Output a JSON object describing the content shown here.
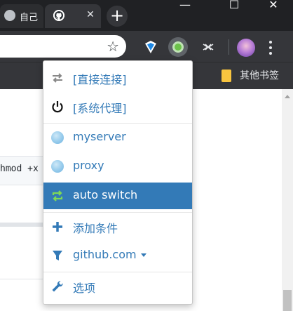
{
  "tabs": [
    {
      "label": "自己"
    },
    {
      "label": ""
    }
  ],
  "window": {
    "minimize": "—",
    "maximize": "☐",
    "close": "✕",
    "new_tab": "+"
  },
  "bookmarks": {
    "other_label": "其他书签"
  },
  "content": {
    "code_text": "hmod +x"
  },
  "menu": {
    "items": [
      {
        "label": "[直接连接]",
        "icon": "swap-arrows-icon"
      },
      {
        "label": "[系统代理]",
        "icon": "power-icon"
      },
      {
        "label": "myserver",
        "icon": "globe-icon"
      },
      {
        "label": "proxy",
        "icon": "globe-icon"
      },
      {
        "label": "auto switch",
        "icon": "auto-switch-icon",
        "active": true
      },
      {
        "label": "添加条件",
        "icon": "plus-icon"
      },
      {
        "label": "github.com",
        "icon": "filter-icon"
      },
      {
        "label": "选项",
        "icon": "wrench-icon"
      }
    ]
  },
  "colors": {
    "accent": "#337ab7",
    "tabbar": "#202124",
    "toolbar": "#35363a"
  }
}
